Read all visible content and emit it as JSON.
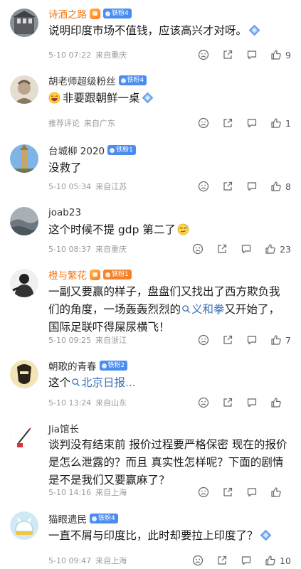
{
  "comments": [
    {
      "name": "诗酒之路",
      "badge": "铁粉4",
      "text": "说明印度市场不值钱，应该高兴才对呀。",
      "time": "5-10 07:22",
      "location": "来自重庆",
      "likes": "9"
    },
    {
      "name": "胡老师超级粉丝",
      "badge": "铁粉4",
      "text": "非要跟朝鲜一桌",
      "time": "推荐评论",
      "location": "来自广东",
      "likes": "1"
    },
    {
      "name": "台城柳 2020",
      "badge": "铁粉1",
      "text": "没救了",
      "time": "5-10 05:34",
      "location": "来自江苏",
      "likes": "8"
    },
    {
      "name": "joab23",
      "text": "这个时候不提 gdp 第二了",
      "time": "5-10 08:37",
      "location": "来自重庆",
      "likes": "23"
    },
    {
      "name": "橙与繁花",
      "badge": "铁粉1",
      "text_part1": "一副又要赢的样子，盘盘们又找出了西方欺负我们的角度，一场轰轰烈烈的",
      "text_link": "义和拳",
      "text_part2": "又开始了，国际足联吓得屎尿横飞！",
      "time": "5-10 09:25",
      "location": "来自浙江",
      "likes": "7"
    },
    {
      "name": "朝歌的青春",
      "badge": "铁粉2",
      "text_part1": "这个",
      "text_link": "北京日报...",
      "time": "5-10 13:24",
      "location": "来自山东",
      "likes": ""
    },
    {
      "name": "Jia馆长",
      "text": "谈判没有结束前 报价过程要严格保密 现在的报价是怎么泄露的？而且 真实性怎样呢？下面的剧情是不是我们又要赢麻了？",
      "time": "5-10 14:16",
      "location": "来自上海",
      "likes": ""
    },
    {
      "name": "猫眼遗民",
      "badge": "铁粉4",
      "text": "一直不屑与印度比，此时却要拉上印度了？",
      "time": "5-10 09:47",
      "location": "来自上海",
      "likes": "10"
    }
  ],
  "colors": {
    "vip_name": "#f07a1a",
    "link": "#3b6fb6",
    "meta": "#9a9a9a",
    "badge_blue": "#4a8cf0",
    "badge_orange": "#f4822a"
  },
  "icons": [
    "dislike-icon",
    "share-icon",
    "comment-icon",
    "like-icon",
    "search-link-icon",
    "diamond-emoji-icon"
  ]
}
